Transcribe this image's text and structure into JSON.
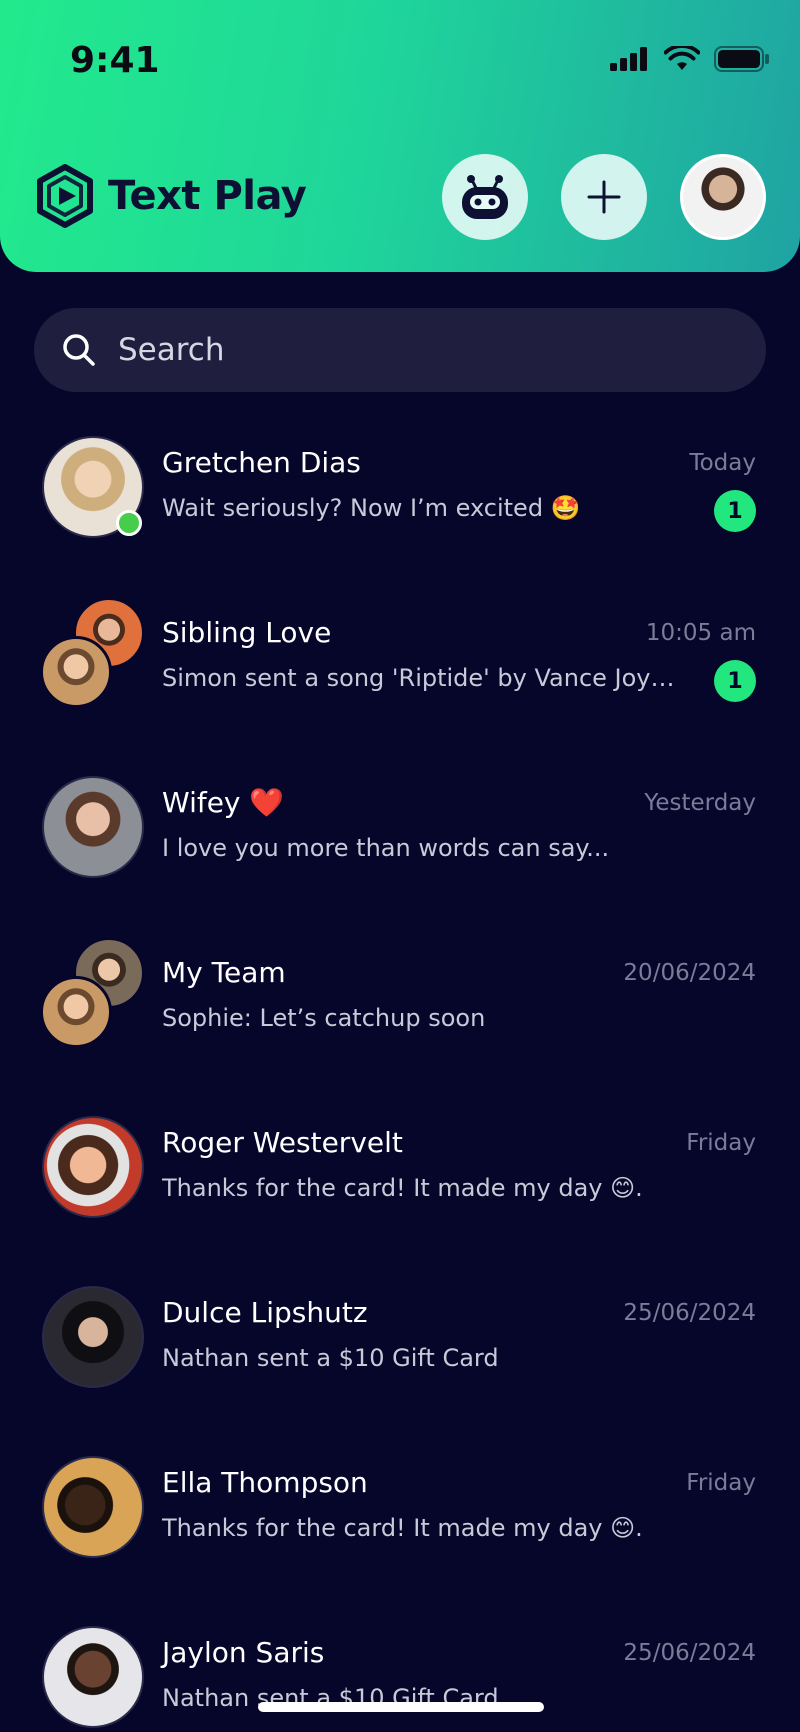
{
  "status": {
    "time": "9:41"
  },
  "header": {
    "app_name": "Text Play"
  },
  "search": {
    "placeholder": "Search"
  },
  "chats": [
    {
      "name": "Gretchen Dias",
      "preview": "Wait seriously? Now I’m excited 🤩",
      "time": "Today",
      "unread": "1",
      "online": true,
      "group": false,
      "avatar_color": "#d8c2a8"
    },
    {
      "name": "Sibling Love",
      "preview": "Simon sent a song 'Riptide' by Vance Joy—de...",
      "time": "10:05 am",
      "unread": "1",
      "online": false,
      "group": true,
      "avatar_color": "#d77a44"
    },
    {
      "name": "Wifey ❤️",
      "preview": "I love you more than words can say...",
      "time": "Yesterday",
      "unread": null,
      "online": false,
      "group": false,
      "avatar_color": "#8a7a72"
    },
    {
      "name": "My Team",
      "preview": "Sophie: Let’s catchup soon",
      "time": "20/06/2024",
      "unread": null,
      "online": false,
      "group": true,
      "avatar_color": "#b09070"
    },
    {
      "name": "Roger Westervelt",
      "preview": "Thanks for the card! It made my day 😊.",
      "time": "Friday",
      "unread": null,
      "online": false,
      "group": false,
      "avatar_color": "#c8775a"
    },
    {
      "name": "Dulce Lipshutz",
      "preview": "Nathan sent a $10 Gift Card",
      "time": "25/06/2024",
      "unread": null,
      "online": false,
      "group": false,
      "avatar_color": "#2e2a2e"
    },
    {
      "name": "Ella Thompson",
      "preview": "Thanks for the card! It made my day 😊.",
      "time": "Friday",
      "unread": null,
      "online": false,
      "group": false,
      "avatar_color": "#d7a35a"
    },
    {
      "name": "Jaylon Saris",
      "preview": "Nathan sent a $10 Gift Card",
      "time": "25/06/2024",
      "unread": null,
      "online": false,
      "group": false,
      "avatar_color": "#5b4a44"
    }
  ],
  "colors": {
    "background": "#06052a",
    "accent": "#22e67e",
    "header_start": "#22ea8c",
    "header_end": "#1fa3a3"
  }
}
